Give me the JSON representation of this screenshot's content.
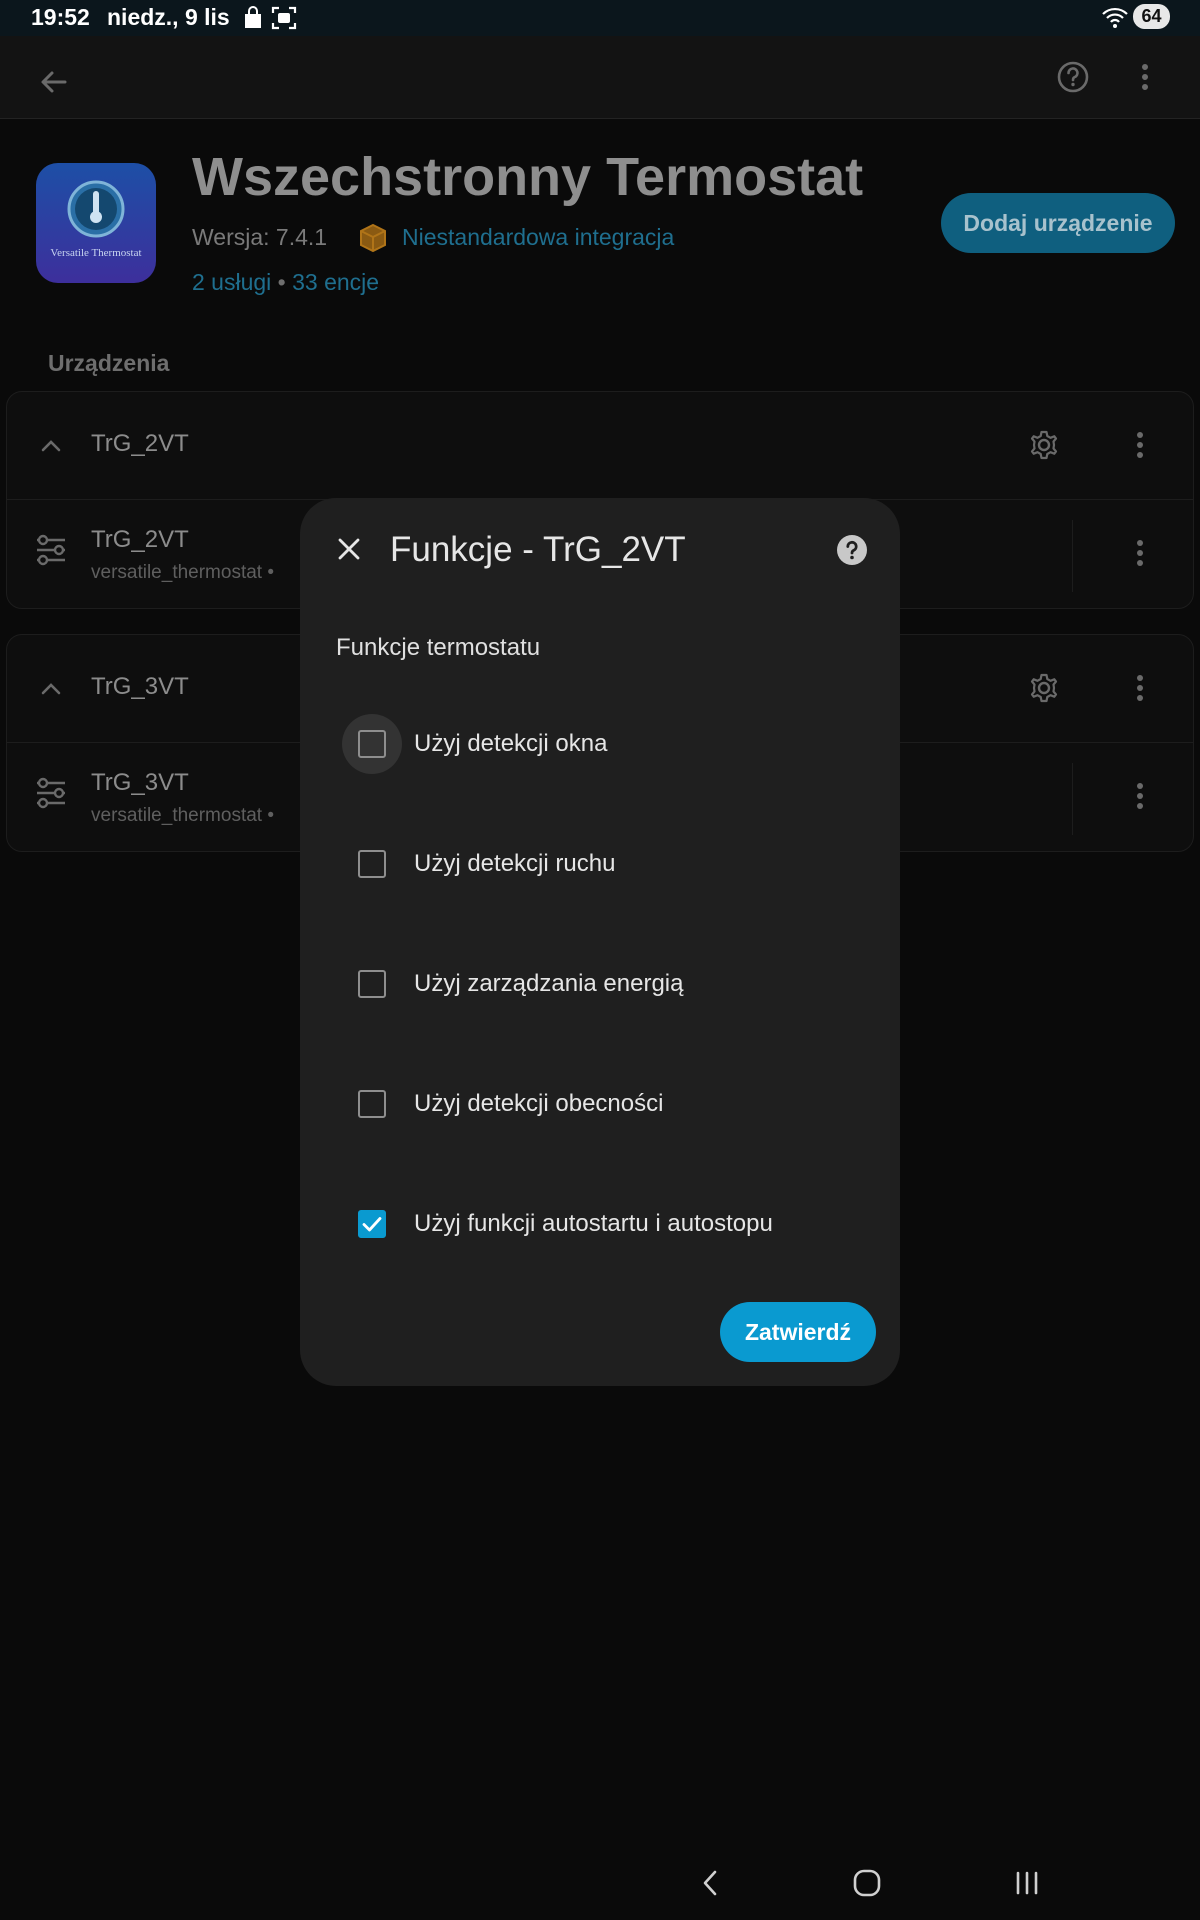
{
  "status_bar": {
    "time": "19:52",
    "date": "niedz., 9 lis",
    "battery": "64"
  },
  "header": {
    "title": "Wszechstronny Termostat",
    "version": "Wersja: 7.4.1",
    "custom_integration": "Niestandardowa integracja",
    "services_link": "2 usługi",
    "separator": "•",
    "entities_link": "33 encje",
    "add_device_label": "Dodaj urządzenie",
    "logo_text": "Versatile Thermostat"
  },
  "devices_section": {
    "label": "Urządzenia",
    "devices": [
      {
        "name": "TrG_2VT",
        "sub_name": "TrG_2VT",
        "sub_id": "versatile_thermostat •"
      },
      {
        "name": "TrG_3VT",
        "sub_name": "TrG_3VT",
        "sub_id": "versatile_thermostat •"
      }
    ]
  },
  "dialog": {
    "title": "Funkcje - TrG_2VT",
    "section_label": "Funkcje termostatu",
    "options": [
      {
        "label": "Użyj detekcji okna",
        "checked": false
      },
      {
        "label": "Użyj detekcji ruchu",
        "checked": false
      },
      {
        "label": "Użyj zarządzania energią",
        "checked": false
      },
      {
        "label": "Użyj detekcji obecności",
        "checked": false
      },
      {
        "label": "Użyj funkcji autostartu i autostopu",
        "checked": true
      }
    ],
    "submit_label": "Zatwierdź"
  },
  "colors": {
    "accent": "#0a9ad0",
    "dialog_bg": "#1f1f1f",
    "page_bg": "#0a0a0a"
  }
}
